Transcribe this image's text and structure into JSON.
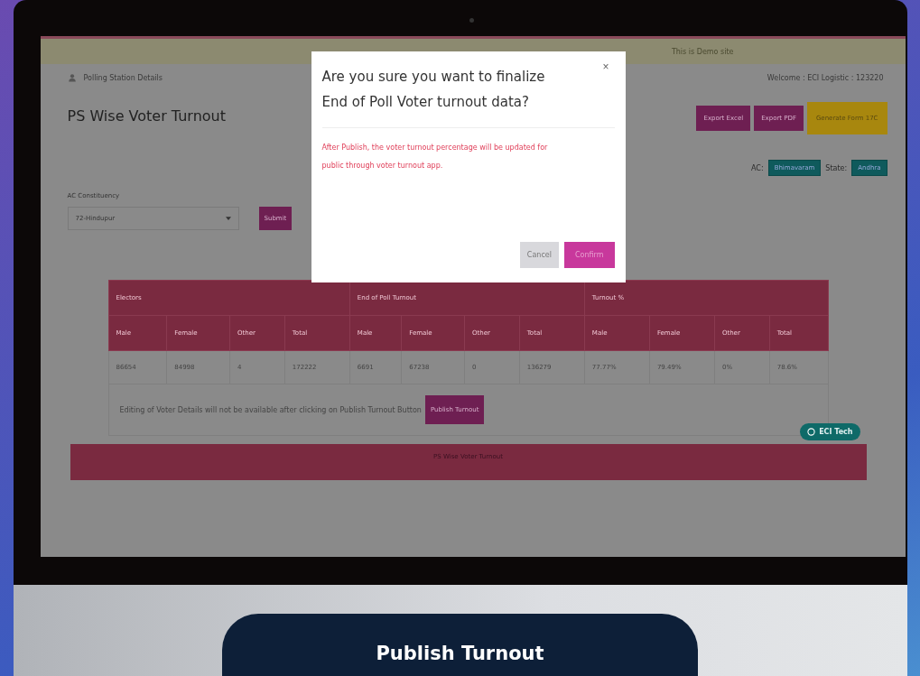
{
  "demo_banner": "This is Demo site",
  "breadcrumb": "Polling Station Details",
  "welcome": "Welcome : ECI Logistic : 123220",
  "page_title": "PS Wise Voter Turnout",
  "action_buttons": [
    {
      "label": "Export Excel",
      "kind": "primary"
    },
    {
      "label": "Export PDF",
      "kind": "primary"
    },
    {
      "label": "Generate Form 17C",
      "kind": "warning"
    }
  ],
  "badges": [
    {
      "label": "AC:",
      "value": "Bhimavaram"
    },
    {
      "label": "State:",
      "value": "Andhra"
    }
  ],
  "filter": {
    "label": "AC Constituency",
    "value": "72-Hindupur",
    "button": "Submit"
  },
  "table": {
    "groups": [
      "Electors",
      "End of Poll Turnout",
      "Turnout %"
    ],
    "columns": [
      "Male",
      "Female",
      "Other",
      "Total",
      "Male",
      "Female",
      "Other",
      "Total",
      "Male",
      "Female",
      "Other",
      "Total"
    ],
    "rows": [
      [
        "86654",
        "84998",
        "4",
        "172222",
        "6691",
        "67238",
        "0",
        "136279",
        "77.77%",
        "79.49%",
        "0%",
        "78.6%"
      ]
    ],
    "note": "Editing of Voter Details will not be available after clicking on Publish Turnout Button",
    "note_button": "Publish Turnout"
  },
  "help_chip": "ECI Tech",
  "footer_bar": "PS Wise Voter Turnout",
  "dialog": {
    "title": "Are you sure you want to finalize End of Poll Voter turnout data?",
    "close": "×",
    "message": "After Publish, the voter turnout percentage will be updated for public through voter turnout app.",
    "buttons": [
      {
        "label": "Cancel",
        "kind": "secondary"
      },
      {
        "label": "Confirm",
        "kind": "primary"
      }
    ]
  },
  "caption_button": "Publish Turnout"
}
